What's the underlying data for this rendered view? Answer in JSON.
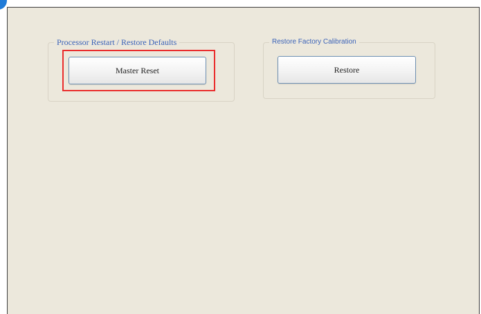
{
  "groups": {
    "processor": {
      "legend": "Processor Restart / Restore Defaults",
      "button_label": "Master Reset",
      "highlighted": true,
      "highlight_color": "#ea2d2d"
    },
    "factory": {
      "legend": "Restore Factory Calibration",
      "button_label": "Restore"
    }
  },
  "theme": {
    "panel_bg": "#ece8dc",
    "legend_color": "#3a62b8",
    "button_border": "#6d8fb2"
  }
}
